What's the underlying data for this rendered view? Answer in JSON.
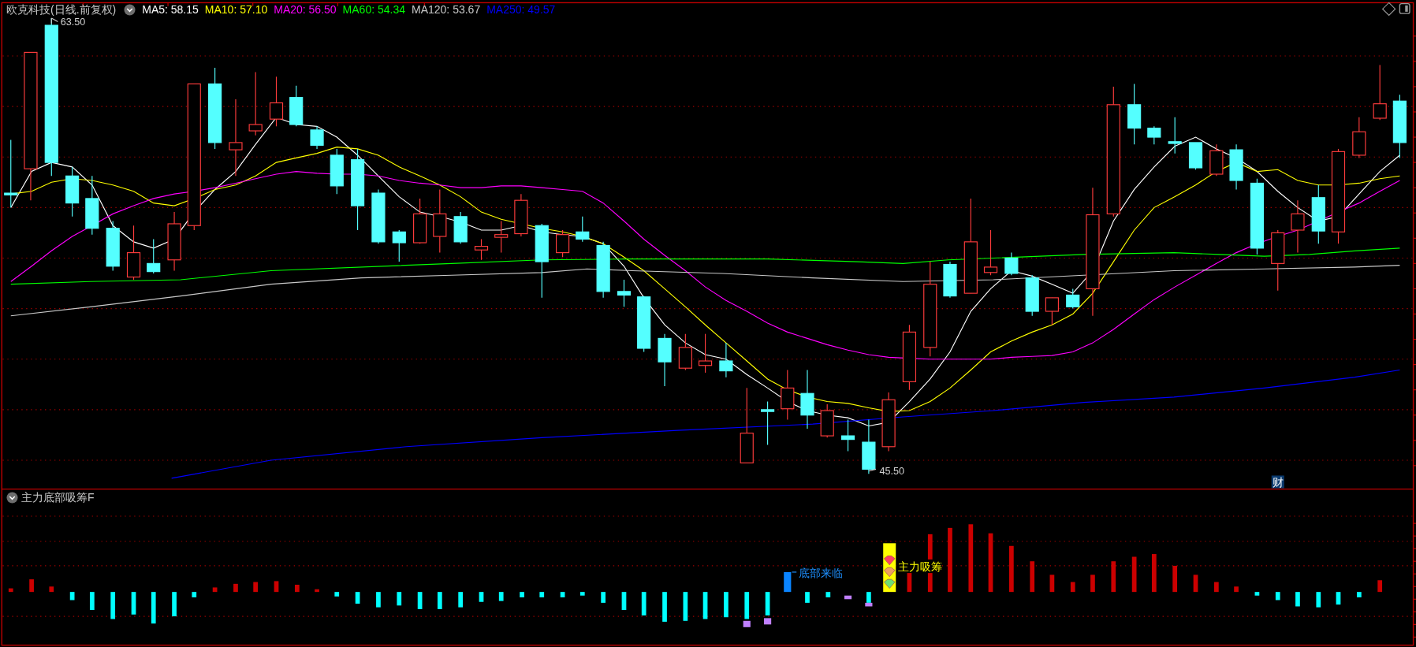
{
  "title": "欧克科技(日线.前复权)",
  "ma_legend": [
    {
      "label": "MA5: 58.15",
      "color": "#ffffff"
    },
    {
      "label": "MA10: 57.10",
      "color": "#ffff00"
    },
    {
      "label": "MA20: 56.50",
      "color": "#ff00ff"
    },
    {
      "label": "MA60: 54.34",
      "color": "#00ff00"
    },
    {
      "label": "MA120: 53.67",
      "color": "#c8c8c8"
    },
    {
      "label": "MA250: 49.57",
      "color": "#0000ff"
    }
  ],
  "high_label": "63.50",
  "low_label": "45.50",
  "finance_badge": "财",
  "indicator": {
    "title": "主力底部吸筹F",
    "signals": [
      {
        "kind": "bottom",
        "text": "底部来临"
      },
      {
        "kind": "accumulate",
        "text": "主力吸筹"
      }
    ]
  }
}
